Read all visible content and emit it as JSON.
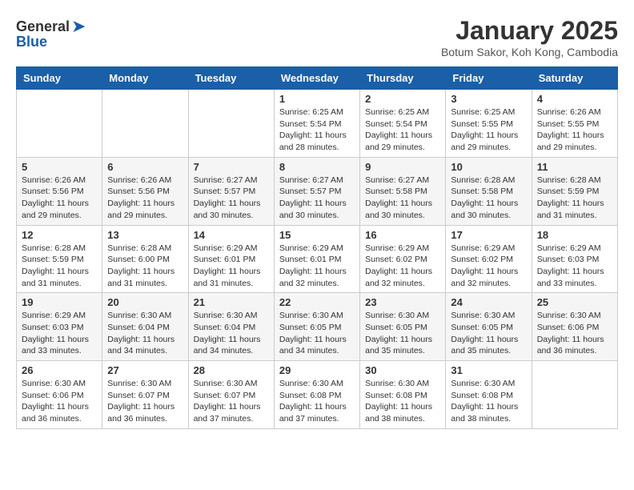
{
  "header": {
    "logo_general": "General",
    "logo_blue": "Blue",
    "month_title": "January 2025",
    "subtitle": "Botum Sakor, Koh Kong, Cambodia"
  },
  "days_of_week": [
    "Sunday",
    "Monday",
    "Tuesday",
    "Wednesday",
    "Thursday",
    "Friday",
    "Saturday"
  ],
  "weeks": [
    [
      {
        "day": "",
        "info": ""
      },
      {
        "day": "",
        "info": ""
      },
      {
        "day": "",
        "info": ""
      },
      {
        "day": "1",
        "info": "Sunrise: 6:25 AM\nSunset: 5:54 PM\nDaylight: 11 hours and 28 minutes."
      },
      {
        "day": "2",
        "info": "Sunrise: 6:25 AM\nSunset: 5:54 PM\nDaylight: 11 hours and 29 minutes."
      },
      {
        "day": "3",
        "info": "Sunrise: 6:25 AM\nSunset: 5:55 PM\nDaylight: 11 hours and 29 minutes."
      },
      {
        "day": "4",
        "info": "Sunrise: 6:26 AM\nSunset: 5:55 PM\nDaylight: 11 hours and 29 minutes."
      }
    ],
    [
      {
        "day": "5",
        "info": "Sunrise: 6:26 AM\nSunset: 5:56 PM\nDaylight: 11 hours and 29 minutes."
      },
      {
        "day": "6",
        "info": "Sunrise: 6:26 AM\nSunset: 5:56 PM\nDaylight: 11 hours and 29 minutes."
      },
      {
        "day": "7",
        "info": "Sunrise: 6:27 AM\nSunset: 5:57 PM\nDaylight: 11 hours and 30 minutes."
      },
      {
        "day": "8",
        "info": "Sunrise: 6:27 AM\nSunset: 5:57 PM\nDaylight: 11 hours and 30 minutes."
      },
      {
        "day": "9",
        "info": "Sunrise: 6:27 AM\nSunset: 5:58 PM\nDaylight: 11 hours and 30 minutes."
      },
      {
        "day": "10",
        "info": "Sunrise: 6:28 AM\nSunset: 5:58 PM\nDaylight: 11 hours and 30 minutes."
      },
      {
        "day": "11",
        "info": "Sunrise: 6:28 AM\nSunset: 5:59 PM\nDaylight: 11 hours and 31 minutes."
      }
    ],
    [
      {
        "day": "12",
        "info": "Sunrise: 6:28 AM\nSunset: 5:59 PM\nDaylight: 11 hours and 31 minutes."
      },
      {
        "day": "13",
        "info": "Sunrise: 6:28 AM\nSunset: 6:00 PM\nDaylight: 11 hours and 31 minutes."
      },
      {
        "day": "14",
        "info": "Sunrise: 6:29 AM\nSunset: 6:01 PM\nDaylight: 11 hours and 31 minutes."
      },
      {
        "day": "15",
        "info": "Sunrise: 6:29 AM\nSunset: 6:01 PM\nDaylight: 11 hours and 32 minutes."
      },
      {
        "day": "16",
        "info": "Sunrise: 6:29 AM\nSunset: 6:02 PM\nDaylight: 11 hours and 32 minutes."
      },
      {
        "day": "17",
        "info": "Sunrise: 6:29 AM\nSunset: 6:02 PM\nDaylight: 11 hours and 32 minutes."
      },
      {
        "day": "18",
        "info": "Sunrise: 6:29 AM\nSunset: 6:03 PM\nDaylight: 11 hours and 33 minutes."
      }
    ],
    [
      {
        "day": "19",
        "info": "Sunrise: 6:29 AM\nSunset: 6:03 PM\nDaylight: 11 hours and 33 minutes."
      },
      {
        "day": "20",
        "info": "Sunrise: 6:30 AM\nSunset: 6:04 PM\nDaylight: 11 hours and 34 minutes."
      },
      {
        "day": "21",
        "info": "Sunrise: 6:30 AM\nSunset: 6:04 PM\nDaylight: 11 hours and 34 minutes."
      },
      {
        "day": "22",
        "info": "Sunrise: 6:30 AM\nSunset: 6:05 PM\nDaylight: 11 hours and 34 minutes."
      },
      {
        "day": "23",
        "info": "Sunrise: 6:30 AM\nSunset: 6:05 PM\nDaylight: 11 hours and 35 minutes."
      },
      {
        "day": "24",
        "info": "Sunrise: 6:30 AM\nSunset: 6:05 PM\nDaylight: 11 hours and 35 minutes."
      },
      {
        "day": "25",
        "info": "Sunrise: 6:30 AM\nSunset: 6:06 PM\nDaylight: 11 hours and 36 minutes."
      }
    ],
    [
      {
        "day": "26",
        "info": "Sunrise: 6:30 AM\nSunset: 6:06 PM\nDaylight: 11 hours and 36 minutes."
      },
      {
        "day": "27",
        "info": "Sunrise: 6:30 AM\nSunset: 6:07 PM\nDaylight: 11 hours and 36 minutes."
      },
      {
        "day": "28",
        "info": "Sunrise: 6:30 AM\nSunset: 6:07 PM\nDaylight: 11 hours and 37 minutes."
      },
      {
        "day": "29",
        "info": "Sunrise: 6:30 AM\nSunset: 6:08 PM\nDaylight: 11 hours and 37 minutes."
      },
      {
        "day": "30",
        "info": "Sunrise: 6:30 AM\nSunset: 6:08 PM\nDaylight: 11 hours and 38 minutes."
      },
      {
        "day": "31",
        "info": "Sunrise: 6:30 AM\nSunset: 6:08 PM\nDaylight: 11 hours and 38 minutes."
      },
      {
        "day": "",
        "info": ""
      }
    ]
  ]
}
